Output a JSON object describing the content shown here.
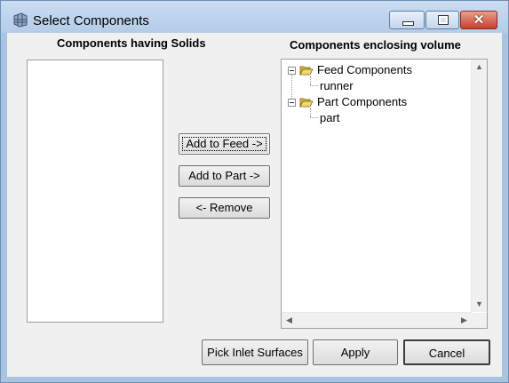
{
  "window": {
    "title": "Select Components",
    "controls": {
      "minimize": "minimize",
      "maximize": "maximize",
      "close": "close"
    }
  },
  "left_panel": {
    "header": "Components having Solids",
    "items": []
  },
  "right_panel": {
    "header": "Components enclosing volume",
    "tree": [
      {
        "label": "Feed Components",
        "expanded": true,
        "children": [
          {
            "label": "runner"
          }
        ]
      },
      {
        "label": "Part Components",
        "expanded": true,
        "children": [
          {
            "label": "part"
          }
        ]
      }
    ]
  },
  "middle_buttons": {
    "add_to_feed": "Add to Feed ->",
    "add_to_part": "Add to Part ->",
    "remove": "<- Remove"
  },
  "bottom_buttons": {
    "pick_inlet": "Pick Inlet Surfaces",
    "apply": "Apply",
    "cancel": "Cancel"
  },
  "icons": {
    "app": "grid-mesh-icon",
    "tree_expander": "minus-box-icon",
    "tree_folder": "open-folder-icon"
  },
  "colors": {
    "title_bar": "#b4cce9",
    "close_button": "#c7402a",
    "dialog_bg": "#f0f0f0",
    "folder": "#e8c75a"
  }
}
